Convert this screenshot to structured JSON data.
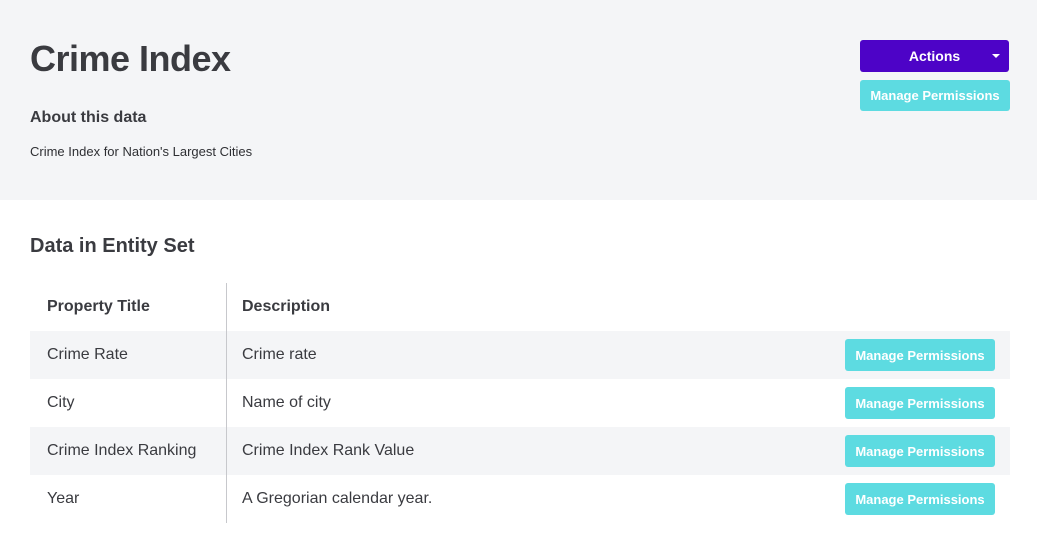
{
  "header": {
    "title": "Crime Index",
    "about_heading": "About this data",
    "about_text": "Crime Index for Nation's Largest Cities",
    "actions_label": "Actions",
    "manage_permissions_label": "Manage Permissions"
  },
  "section": {
    "title": "Data in Entity Set"
  },
  "table": {
    "columns": [
      "Property Title",
      "Description"
    ],
    "rows": [
      {
        "title": "Crime Rate",
        "description": "Crime rate",
        "button": "Manage Permissions"
      },
      {
        "title": "City",
        "description": "Name of city",
        "button": "Manage Permissions"
      },
      {
        "title": "Crime Index Ranking",
        "description": "Crime Index Rank Value",
        "button": "Manage Permissions"
      },
      {
        "title": "Year",
        "description": "A Gregorian calendar year.",
        "button": "Manage Permissions"
      }
    ]
  },
  "colors": {
    "accent_purple": "#4d03c7",
    "accent_teal": "#5ddbe1",
    "header_bg": "#f4f5f7"
  },
  "icons": {
    "actions_caret": "caret-down-icon"
  }
}
